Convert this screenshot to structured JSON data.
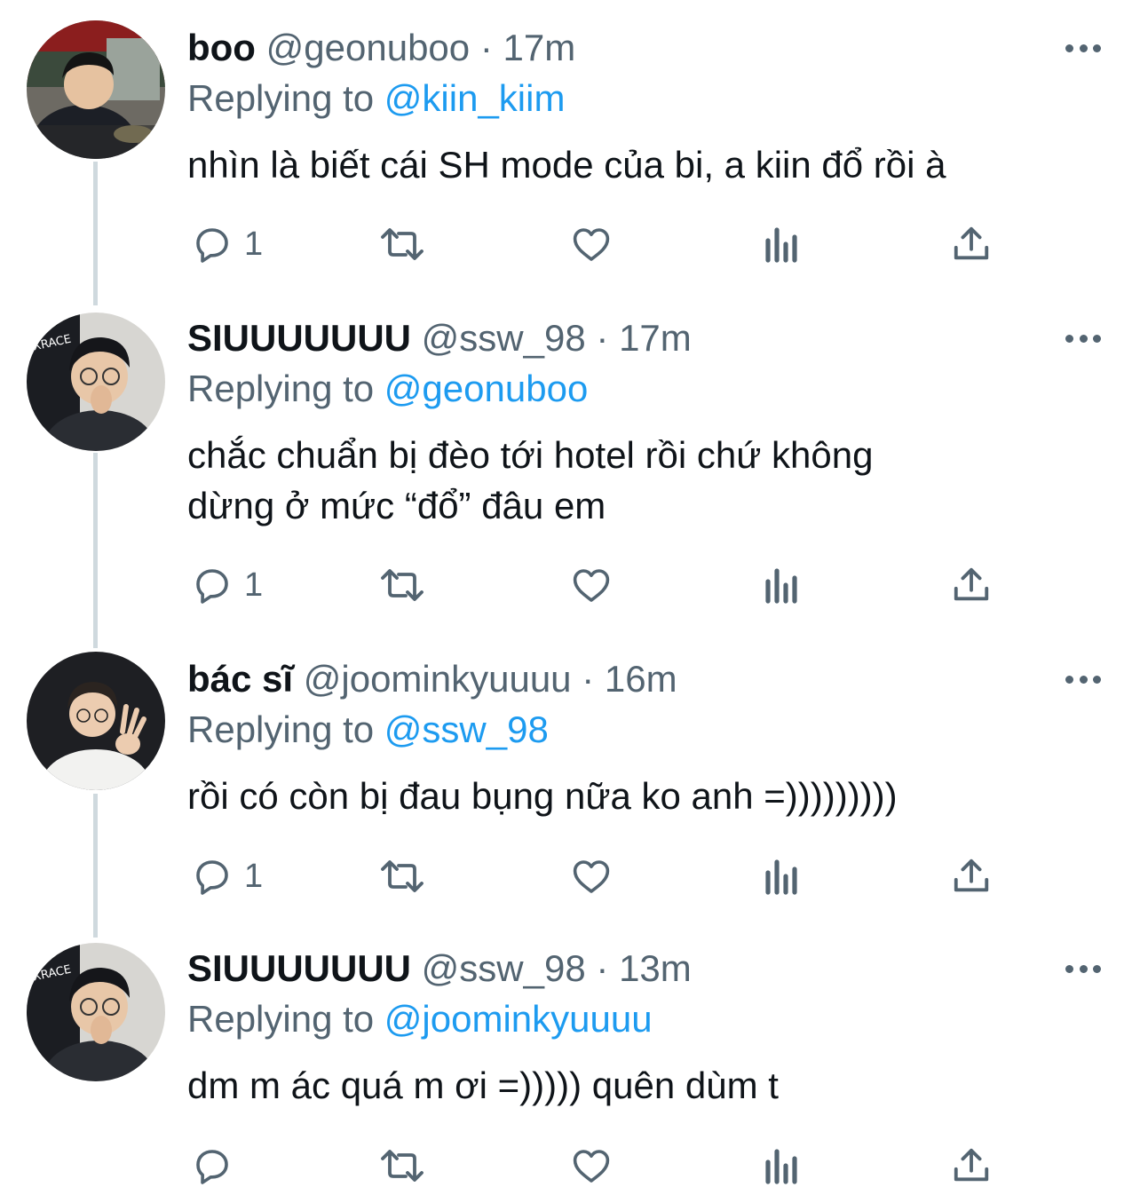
{
  "colors": {
    "accent": "#1d9bf0",
    "secondary": "#536471",
    "thread_line": "#cfd9de"
  },
  "tweets": [
    {
      "name": "boo",
      "handle": "@geonuboo",
      "sep": "·",
      "time": "17m",
      "replying_prefix": "Replying to",
      "replying_to": "@kiin_kiim",
      "text_lines": [
        "nhìn là biết cái SH mode của bi, a kiin đổ rồi à"
      ],
      "reply_count": "1",
      "icons": {
        "reply": "reply-icon",
        "retweet": "retweet-icon",
        "like": "heart-icon",
        "analytics": "analytics-icon",
        "share": "share-icon",
        "more": "more-icon"
      }
    },
    {
      "name": "SIUUUUUUU",
      "handle": "@ssw_98",
      "sep": "·",
      "time": "17m",
      "replying_prefix": "Replying to",
      "replying_to": "@geonuboo",
      "text_lines": [
        "chắc chuẩn bị đèo tới hotel rồi chứ không",
        "dừng ở mức “đổ” đâu em"
      ],
      "reply_count": "1",
      "icons": {
        "reply": "reply-icon",
        "retweet": "retweet-icon",
        "like": "heart-icon",
        "analytics": "analytics-icon",
        "share": "share-icon",
        "more": "more-icon"
      }
    },
    {
      "name": "bác sĩ",
      "handle": "@joominkyuuuu",
      "sep": "·",
      "time": "16m",
      "replying_prefix": "Replying to",
      "replying_to": "@ssw_98",
      "text_lines": [
        "rồi có còn bị đau bụng nữa ko anh =)))))))))"
      ],
      "reply_count": "1",
      "icons": {
        "reply": "reply-icon",
        "retweet": "retweet-icon",
        "like": "heart-icon",
        "analytics": "analytics-icon",
        "share": "share-icon",
        "more": "more-icon"
      }
    },
    {
      "name": "SIUUUUUUU",
      "handle": "@ssw_98",
      "sep": "·",
      "time": "13m",
      "replying_prefix": "Replying to",
      "replying_to": "@joominkyuuuu",
      "text_lines": [
        "dm m ác quá m ơi =))))) quên dùm t"
      ],
      "reply_count": "",
      "icons": {
        "reply": "reply-icon",
        "retweet": "retweet-icon",
        "like": "heart-icon",
        "analytics": "analytics-icon",
        "share": "share-icon",
        "more": "more-icon"
      }
    }
  ]
}
